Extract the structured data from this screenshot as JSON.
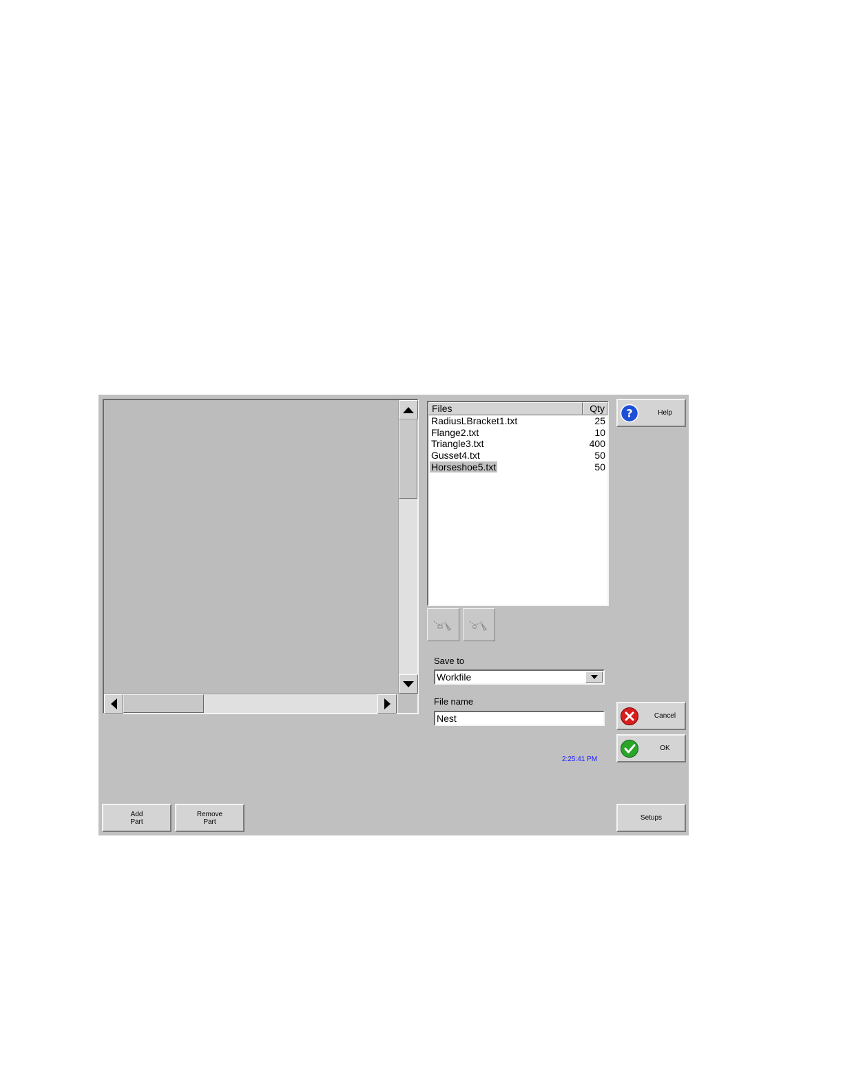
{
  "files_list": {
    "header_files": "Files",
    "header_qty": "Qty",
    "rows": [
      {
        "name": "RadiusLBracket1.txt",
        "qty": "25"
      },
      {
        "name": "Flange2.txt",
        "qty": "10"
      },
      {
        "name": "Triangle3.txt",
        "qty": "400"
      },
      {
        "name": "Gusset4.txt",
        "qty": "50"
      },
      {
        "name": "Horseshoe5.txt",
        "qty": "50"
      }
    ],
    "selected_row": "Horseshoe5.txt"
  },
  "save_to": {
    "label": "Save to",
    "value": "Workfile"
  },
  "file_name": {
    "label": "File name",
    "value": "Nest"
  },
  "buttons": {
    "help": "Help",
    "cancel": "Cancel",
    "ok": "OK",
    "setups": "Setups",
    "add_part_line1": "Add",
    "add_part_line2": "Part",
    "remove_part_line1": "Remove",
    "remove_part_line2": "Part"
  },
  "clock": "2:25:41 PM",
  "colors": {
    "panel_bg": "#c0c0c0",
    "clock_text": "#1a1aff",
    "help_icon": "#1e4fd8",
    "cancel_icon": "#d81e1e",
    "ok_icon": "#2aa52a"
  }
}
